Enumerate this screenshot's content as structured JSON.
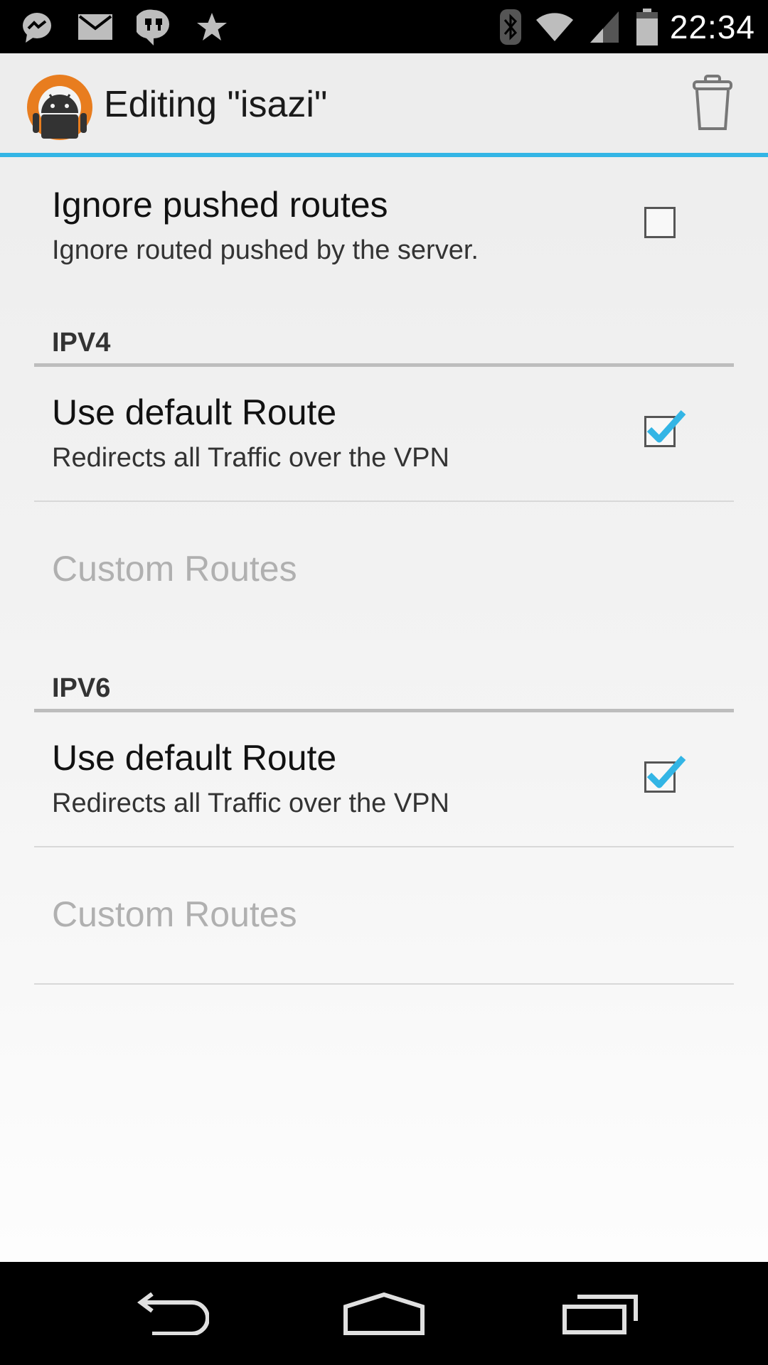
{
  "status_bar": {
    "time": "22:34",
    "left_icons": [
      "messenger-icon",
      "gmail-icon",
      "hangouts-icon",
      "star-icon"
    ],
    "right_icons": [
      "bluetooth-icon",
      "wifi-icon",
      "signal-icon",
      "battery-icon"
    ]
  },
  "action_bar": {
    "title": "Editing \"isazi\"",
    "app_icon": "openvpn-android-logo",
    "delete_icon": "trash-icon"
  },
  "preferences": {
    "ignore_routes": {
      "title": "Ignore pushed routes",
      "summary": "Ignore routed pushed by the server.",
      "checked": false
    },
    "ipv4": {
      "header": "IPV4",
      "default_route": {
        "title": "Use default Route",
        "summary": "Redirects all Traffic over the VPN",
        "checked": true
      },
      "custom_routes": "Custom Routes"
    },
    "ipv6": {
      "header": "IPV6",
      "default_route": {
        "title": "Use default Route",
        "summary": "Redirects all Traffic over the VPN",
        "checked": true
      },
      "custom_routes": "Custom Routes"
    }
  },
  "nav_bar": {
    "buttons": [
      "back-icon",
      "home-icon",
      "recents-icon"
    ]
  },
  "colors": {
    "accent": "#33b5e5",
    "check": "#33b5e5",
    "disabled_text": "#b0b0b0"
  }
}
